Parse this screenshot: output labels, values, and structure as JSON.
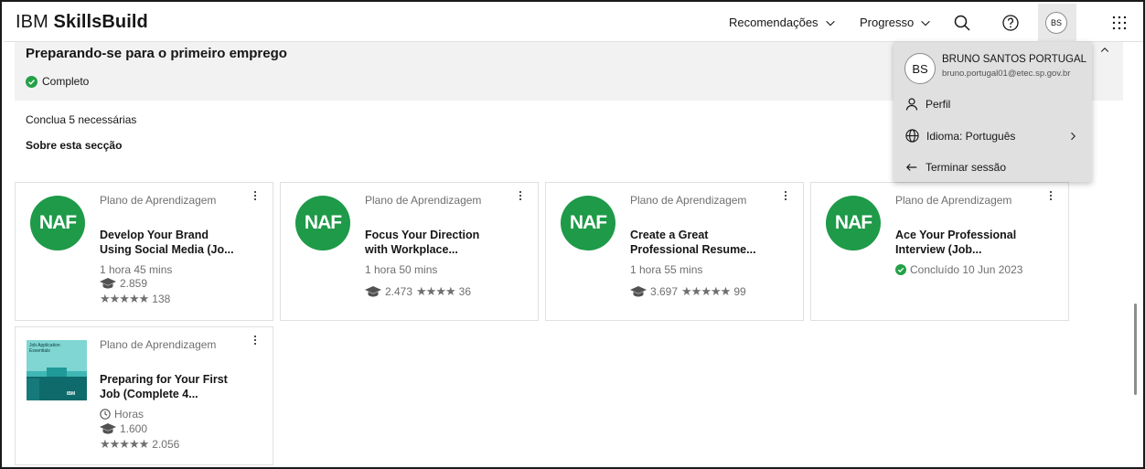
{
  "header": {
    "brand_light": "IBM",
    "brand_bold": "SkillsBuild",
    "nav_recomendacoes": "Recomendações",
    "nav_progresso": "Progresso",
    "avatar_initials": "BS"
  },
  "section": {
    "title": "Preparando-se para o primeiro emprego",
    "status": "Completo",
    "required": "Conclua 5 necessárias",
    "about": "Sobre esta secção"
  },
  "cards": [
    {
      "logo": "NAF",
      "type": "Plano de Aprendizagem",
      "title_line1": "Develop Your Brand",
      "title_line2": "Using Social Media (Jo...",
      "duration": "1 hora 45 mins",
      "enrolled": "2.859",
      "stars": "★★★★★",
      "ratings": "138"
    },
    {
      "logo": "NAF",
      "type": "Plano de Aprendizagem",
      "title_line1": "Focus Your Direction",
      "title_line2": "with Workplace...",
      "duration": "1 hora 50 mins",
      "enrolled": "2.473",
      "stars": "★★★★",
      "ratings": "36"
    },
    {
      "logo": "NAF",
      "type": "Plano de Aprendizagem",
      "title_line1": "Create a Great",
      "title_line2": "Professional Resume...",
      "duration": "1 hora 55 mins",
      "enrolled": "3.697",
      "stars": "★★★★★",
      "ratings": "99"
    },
    {
      "logo": "NAF",
      "type": "Plano de Aprendizagem",
      "title_line1": "Ace Your Professional",
      "title_line2": "Interview (Job...",
      "completed": "Concluído 10 Jun 2023"
    },
    {
      "thumb_line1": "Job Application",
      "thumb_line2": "Essentials",
      "thumb_brand": "IBM",
      "type": "Plano de Aprendizagem",
      "title_line1": "Preparing for Your First",
      "title_line2": "Job (Complete 4...",
      "duration": "Horas",
      "enrolled": "1.600",
      "stars": "★★★★★",
      "ratings": "2.056"
    }
  ],
  "menu": {
    "initials": "BS",
    "name": "BRUNO SANTOS PORTUGAL",
    "email": "bruno.portugal01@etec.sp.gov.br",
    "profile": "Perfil",
    "language": "Idioma: Português",
    "logout": "Terminar sessão"
  },
  "colors": {
    "accent_green": "#1e9a48",
    "check_green": "#24a148",
    "band_gray": "#f2f2f2",
    "menu_gray": "#e0e0e0"
  }
}
